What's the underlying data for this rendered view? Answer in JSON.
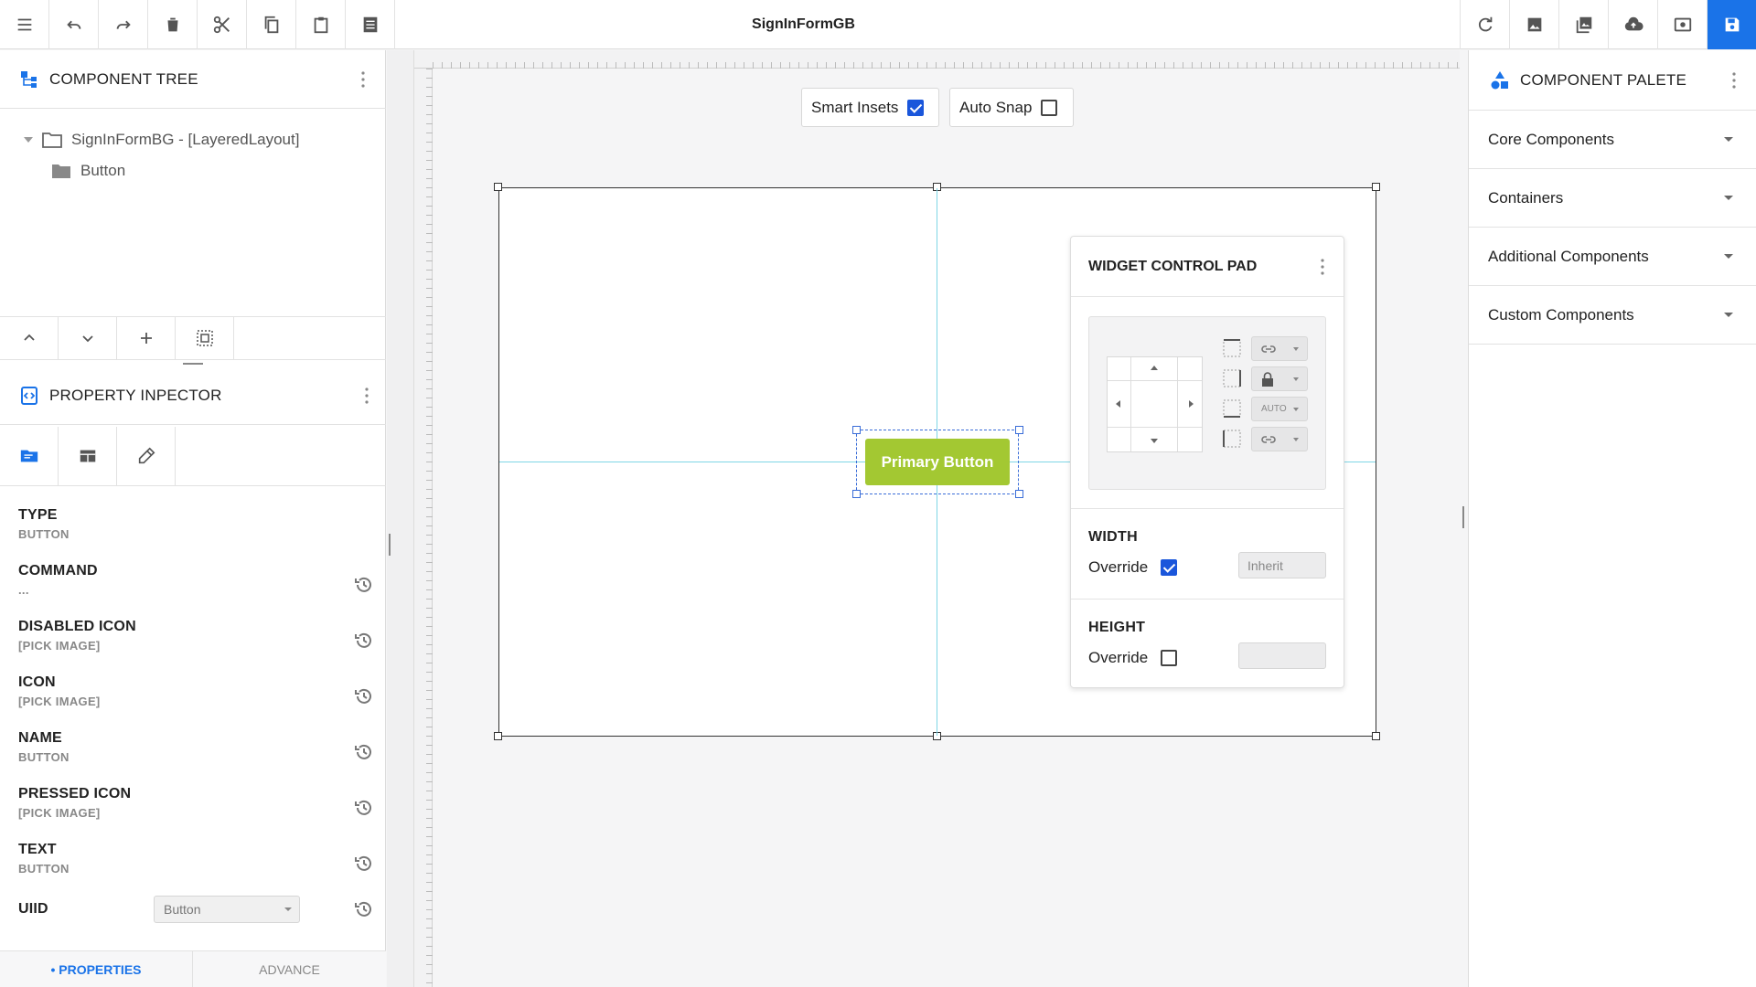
{
  "window": {
    "title": "SignInFormGB"
  },
  "toolbar": {
    "left_icons": [
      "menu-icon",
      "undo-icon",
      "redo-icon",
      "delete-icon",
      "cut-icon",
      "copy-icon",
      "paste-icon",
      "list-icon"
    ],
    "right_icons": [
      "refresh-icon",
      "image-icon",
      "images-icon",
      "cloud-upload-icon",
      "preview-icon",
      "save-icon"
    ]
  },
  "component_tree": {
    "title": "COMPONENT TREE",
    "root": "SignInFormBG - [LayeredLayout]",
    "child": "Button"
  },
  "property_inspector": {
    "title": "PROPERTY INPECTOR",
    "properties": [
      {
        "name": "TYPE",
        "value": "BUTTON"
      },
      {
        "name": "COMMAND",
        "value": "..."
      },
      {
        "name": "DISABLED ICON",
        "value": "[PICK IMAGE]"
      },
      {
        "name": "ICON",
        "value": "[PICK IMAGE]"
      },
      {
        "name": "NAME",
        "value": "BUTTON"
      },
      {
        "name": "PRESSED ICON",
        "value": "[PICK IMAGE]"
      },
      {
        "name": "TEXT",
        "value": "BUTTON"
      }
    ],
    "uiid": {
      "label": "UIID",
      "value": "Button"
    },
    "tabs": {
      "properties": "• PROPERTIES",
      "advance": "ADVANCE"
    }
  },
  "canvas": {
    "smart_insets": {
      "label": "Smart Insets",
      "checked": true
    },
    "auto_snap": {
      "label": "Auto Snap",
      "checked": false
    },
    "selected_button": "Primary Button",
    "accent_color": "#a3c832"
  },
  "widget_control_pad": {
    "title": "WIDGET CONTROL PAD",
    "inset_rows": [
      {
        "icon": "link-icon",
        "value": ""
      },
      {
        "icon": "lock-icon",
        "value": ""
      },
      {
        "icon": "",
        "value": "AUTO"
      },
      {
        "icon": "link-icon",
        "value": ""
      }
    ],
    "width": {
      "title": "WIDTH",
      "override_label": "Override",
      "override": true,
      "value": "Inherit"
    },
    "height": {
      "title": "HEIGHT",
      "override_label": "Override",
      "override": false,
      "value": ""
    }
  },
  "component_palette": {
    "title": "COMPONENT PALETE",
    "sections": [
      "Core Components",
      "Containers",
      "Additional Components",
      "Custom Components"
    ]
  },
  "colors": {
    "primary": "#1a73e8",
    "checkbox": "#1a56db",
    "guide": "#7fd6e6"
  }
}
